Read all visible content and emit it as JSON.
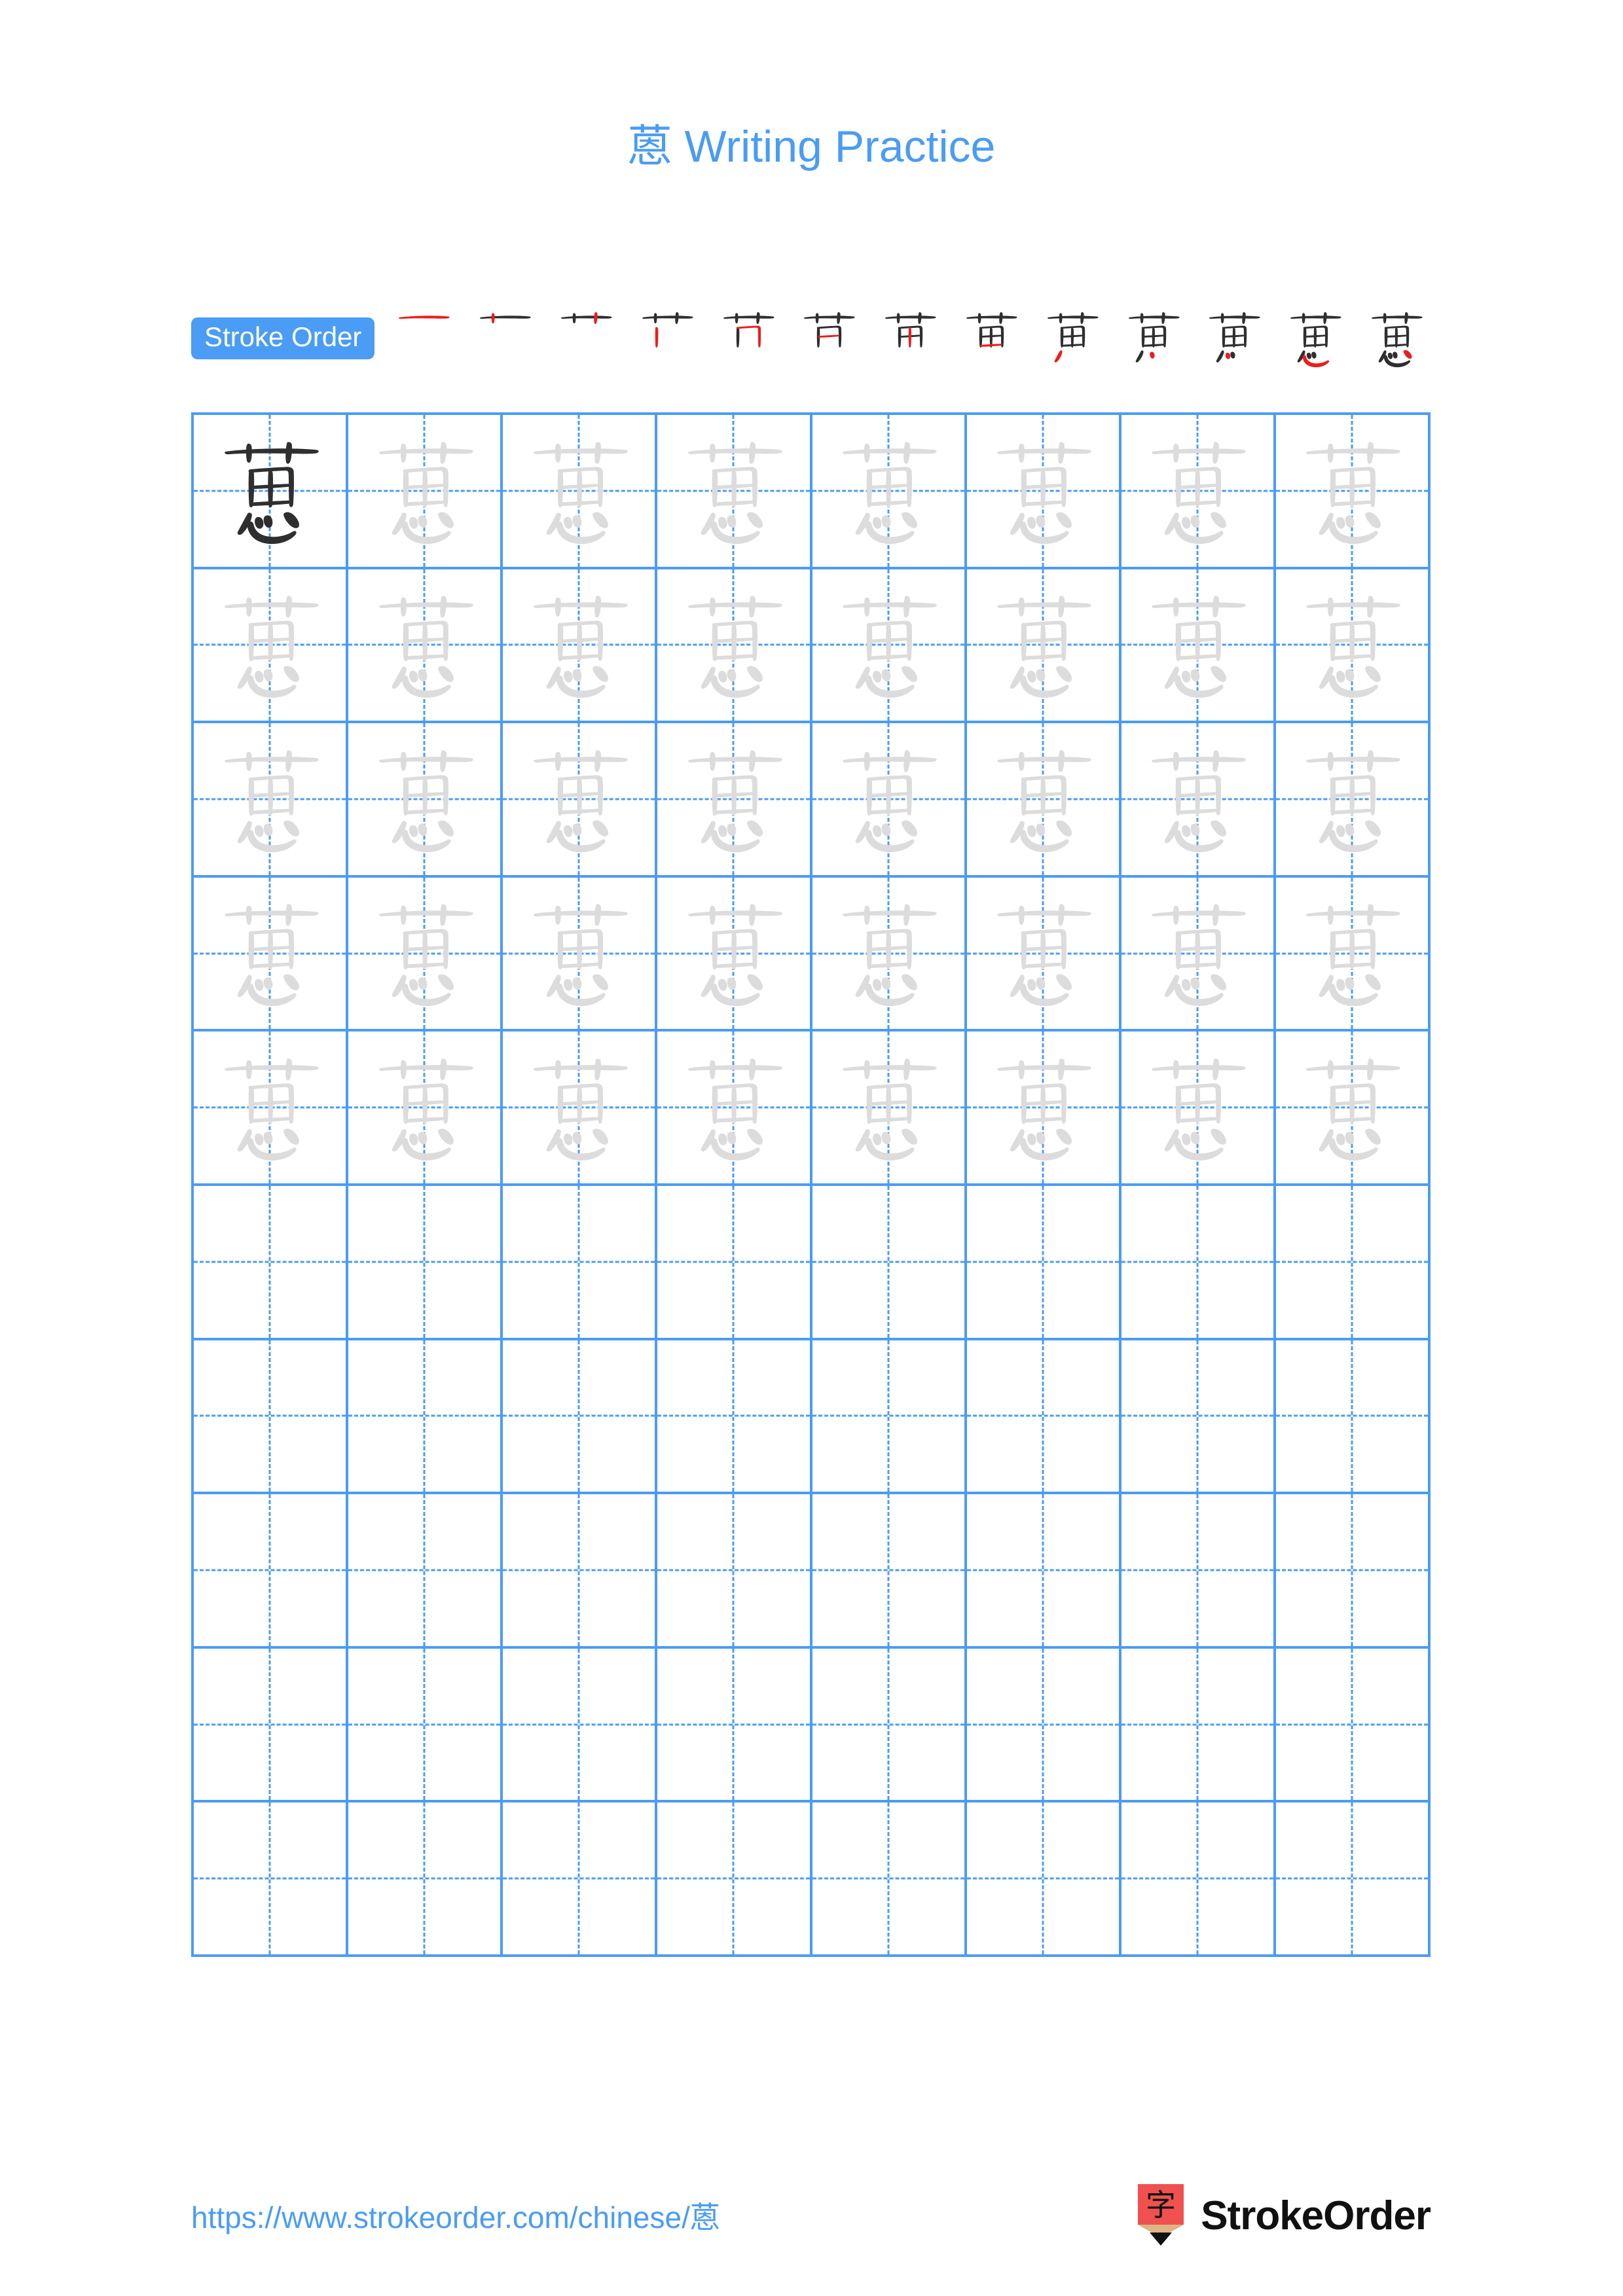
{
  "character": "蒽",
  "header": {
    "title": "蒽 Writing Practice",
    "title_color": "#4a9cf5"
  },
  "stroke_order": {
    "badge_label": "Stroke Order",
    "badge_bg": "#4a9cf5",
    "badge_text_color": "#ffffff",
    "total_strokes": 13,
    "done_color": "#2f2f2f",
    "new_stroke_color": "#ee1c1c",
    "steps": [
      {
        "index": 1,
        "glyph": "一"
      },
      {
        "index": 2,
        "glyph": "十"
      },
      {
        "index": 3,
        "glyph": "艹"
      },
      {
        "index": 4,
        "glyph": "艹"
      },
      {
        "index": 5,
        "glyph": "艻"
      },
      {
        "index": 6,
        "glyph": "苎"
      },
      {
        "index": 7,
        "glyph": "苗"
      },
      {
        "index": 8,
        "glyph": "苗"
      },
      {
        "index": 9,
        "glyph": "苗"
      },
      {
        "index": 10,
        "glyph": "蒽"
      },
      {
        "index": 11,
        "glyph": "蒽"
      },
      {
        "index": 12,
        "glyph": "蒽"
      },
      {
        "index": 13,
        "glyph": "蒽"
      }
    ]
  },
  "grid": {
    "columns": 8,
    "rows": 10,
    "border_color": "#4a9cf5",
    "guide_color": "#4a9cf5",
    "dark_char_color": "#2f2f2f",
    "light_char_color": "#dcdcdc",
    "cells": [
      "dark",
      "light",
      "light",
      "light",
      "light",
      "light",
      "light",
      "light",
      "light",
      "light",
      "light",
      "light",
      "light",
      "light",
      "light",
      "light",
      "light",
      "light",
      "light",
      "light",
      "light",
      "light",
      "light",
      "light",
      "light",
      "light",
      "light",
      "light",
      "light",
      "light",
      "light",
      "light",
      "light",
      "light",
      "light",
      "light",
      "light",
      "light",
      "light",
      "light",
      "empty",
      "empty",
      "empty",
      "empty",
      "empty",
      "empty",
      "empty",
      "empty",
      "empty",
      "empty",
      "empty",
      "empty",
      "empty",
      "empty",
      "empty",
      "empty",
      "empty",
      "empty",
      "empty",
      "empty",
      "empty",
      "empty",
      "empty",
      "empty",
      "empty",
      "empty",
      "empty",
      "empty",
      "empty",
      "empty",
      "empty",
      "empty",
      "empty",
      "empty",
      "empty",
      "empty",
      "empty",
      "empty",
      "empty",
      "empty"
    ]
  },
  "footer": {
    "url": "https://www.strokeorder.com/chinese/蒽",
    "url_color": "#4a9cf5",
    "brand_name": "StrokeOrder",
    "logo_icon": "pencil-zi-icon",
    "logo_char": "字",
    "logo_bg": "#f0514f",
    "logo_wood": "#dcb486"
  }
}
